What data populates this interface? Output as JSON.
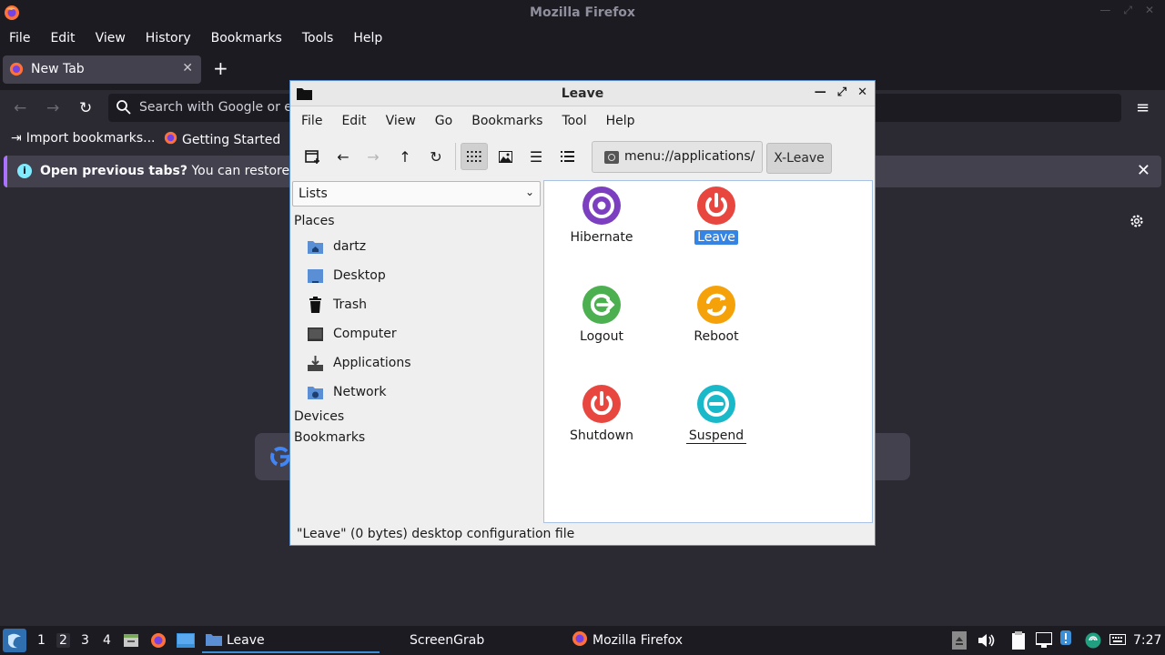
{
  "firefox": {
    "window_title": "Mozilla Firefox",
    "menu": [
      "File",
      "Edit",
      "View",
      "History",
      "Bookmarks",
      "Tools",
      "Help"
    ],
    "tab": {
      "label": "New Tab"
    },
    "urlbar": {
      "placeholder": "Search with Google or e"
    },
    "bookmarks": [
      {
        "label": "Import bookmarks...",
        "icon": "import-icon"
      },
      {
        "label": "Getting Started",
        "icon": "firefox-icon"
      }
    ],
    "notification": {
      "title": "Open previous tabs?",
      "text": "You can restore y"
    }
  },
  "filemanager": {
    "title": "Leave",
    "menu": [
      "File",
      "Edit",
      "View",
      "Go",
      "Bookmarks",
      "Tool",
      "Help"
    ],
    "path": "menu://applications/",
    "crumb": "X-Leave",
    "side_select": "Lists",
    "places_heading": "Places",
    "places": [
      {
        "label": "dartz",
        "icon": "home-folder-icon"
      },
      {
        "label": "Desktop",
        "icon": "desktop-icon"
      },
      {
        "label": "Trash",
        "icon": "trash-icon"
      },
      {
        "label": "Computer",
        "icon": "computer-icon"
      },
      {
        "label": "Applications",
        "icon": "applications-icon"
      },
      {
        "label": "Network",
        "icon": "network-folder-icon"
      }
    ],
    "devices_heading": "Devices",
    "bookmarks_heading": "Bookmarks",
    "items": [
      {
        "label": "Hibernate",
        "icon": "hibernate-icon",
        "color": "#7b3fbf"
      },
      {
        "label": "Leave",
        "icon": "power-icon",
        "color": "#e8473f",
        "selected": true
      },
      {
        "label": "Logout",
        "icon": "logout-icon",
        "color": "#4caf50"
      },
      {
        "label": "Reboot",
        "icon": "reboot-icon",
        "color": "#f5a20a"
      },
      {
        "label": "Shutdown",
        "icon": "shutdown-icon",
        "color": "#e8473f"
      },
      {
        "label": "Suspend",
        "icon": "suspend-icon",
        "color": "#19b9c9"
      }
    ],
    "status": "\"Leave\" (0 bytes) desktop configuration file"
  },
  "taskbar": {
    "workspaces": [
      "1",
      "2",
      "3",
      "4"
    ],
    "current_workspace": "2",
    "tasks": [
      {
        "label": "Leave",
        "icon": "folder-icon"
      },
      {
        "label": "ScreenGrab",
        "icon": ""
      },
      {
        "label": "Mozilla Firefox",
        "icon": "firefox-icon"
      }
    ],
    "clock": "7:27"
  }
}
